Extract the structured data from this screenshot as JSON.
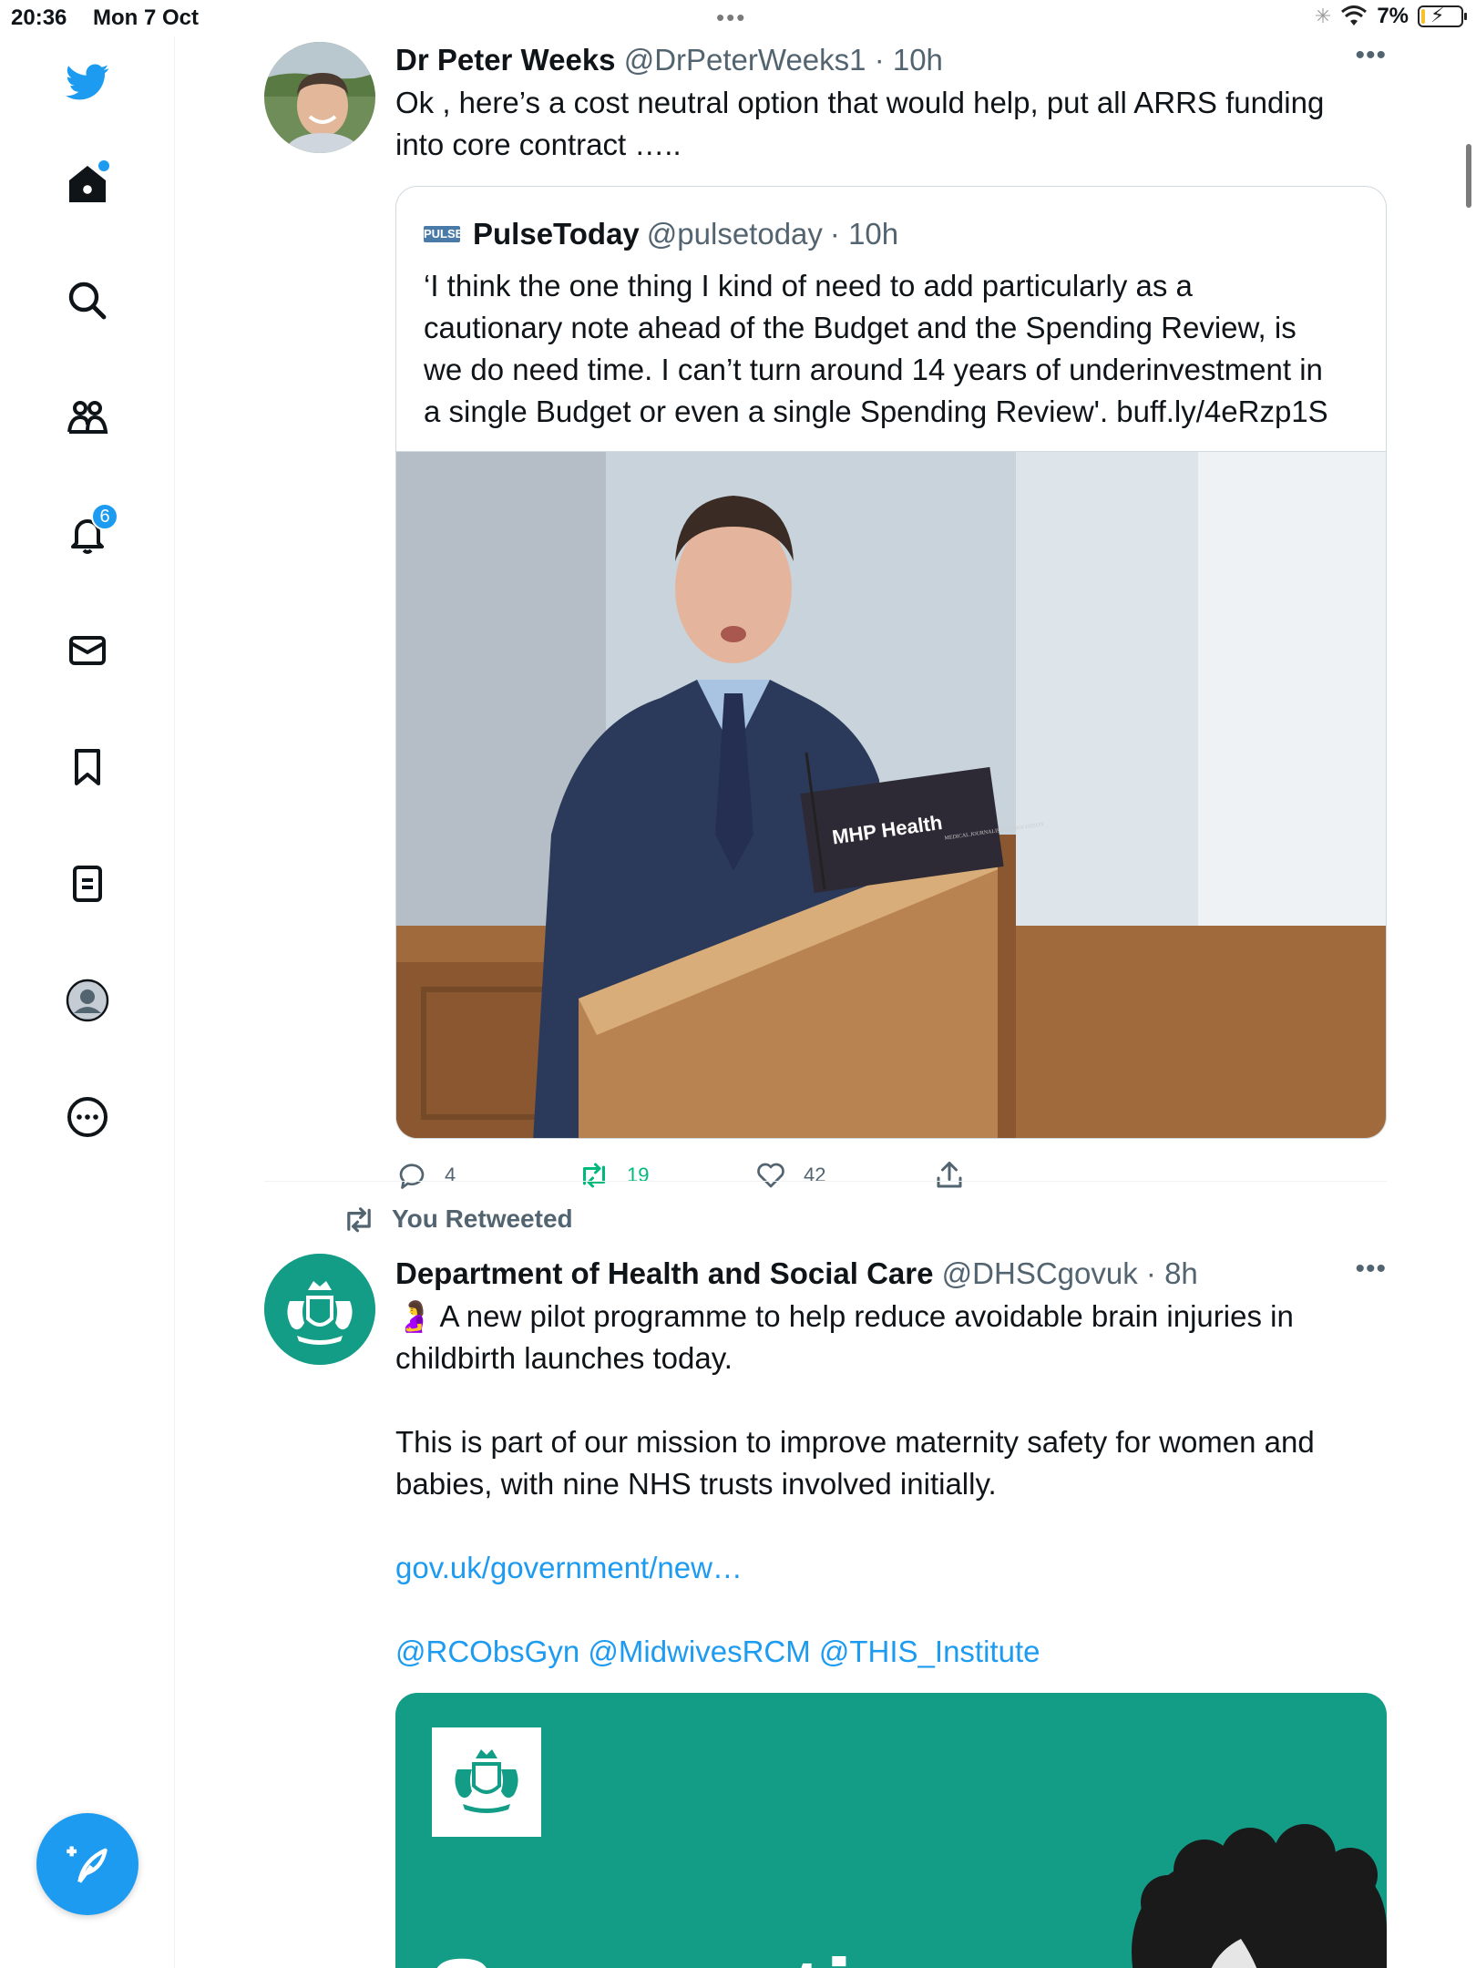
{
  "status_bar": {
    "time": "20:36",
    "date": "Mon 7 Oct",
    "battery": "7%"
  },
  "sidebar": {
    "notification_count": "6",
    "items": [
      "twitter-logo",
      "home-icon",
      "search-icon",
      "communities-icon",
      "notifications-icon",
      "messages-icon",
      "bookmarks-icon",
      "lists-icon",
      "profile-icon",
      "more-icon"
    ]
  },
  "tweet1": {
    "name": "Dr Peter Weeks",
    "handle": "@DrPeterWeeks1",
    "time": "· 10h",
    "text_line1": "Ok , here’s a cost neutral option that would help, put all ARRS funding",
    "text_line2": "into core contract …..",
    "quote": {
      "logo_text": "PULSE",
      "name": "PulseToday",
      "handle": "@pulsetoday",
      "time": "· 10h",
      "line1": "‘I think the one thing I kind of need to add particularly as a",
      "line2": "cautionary note ahead of the Budget and the Spending Review, is",
      "line3": "we do need time. I can’t turn around 14 years of underinvestment in",
      "line4_text": "a single Budget or even a single Spending Review'. ",
      "line4_link": "buff.ly/4eRzp1S",
      "image_sign": "MHP Health",
      "image_sign_small": "MEDICAL JOURNALISTS' ASSOCIATION"
    },
    "replies": "4",
    "retweets": "19",
    "likes": "42"
  },
  "tweet2": {
    "retweet_label": "You Retweeted",
    "name": "Department of Health and Social Care",
    "handle": "@DHSCgovuk",
    "time": "· 8h",
    "emoji": "🤰",
    "line1": " A new pilot programme to help reduce avoidable brain injuries in",
    "line2": "childbirth launches today.",
    "line3": "This is part of our mission to improve maternity safety for women and",
    "line4": "babies, with nine NHS trusts involved initially.",
    "link": "gov.uk/government/new…",
    "mentions": "@RCObsGyn @MidwivesRCM @THIS_Institute",
    "media_word": "Supporting"
  },
  "colors": {
    "accent": "#1d9bf0",
    "retweet_green": "#00ba7c",
    "dhsc_teal": "#149d86",
    "secondary_text": "#536471"
  }
}
